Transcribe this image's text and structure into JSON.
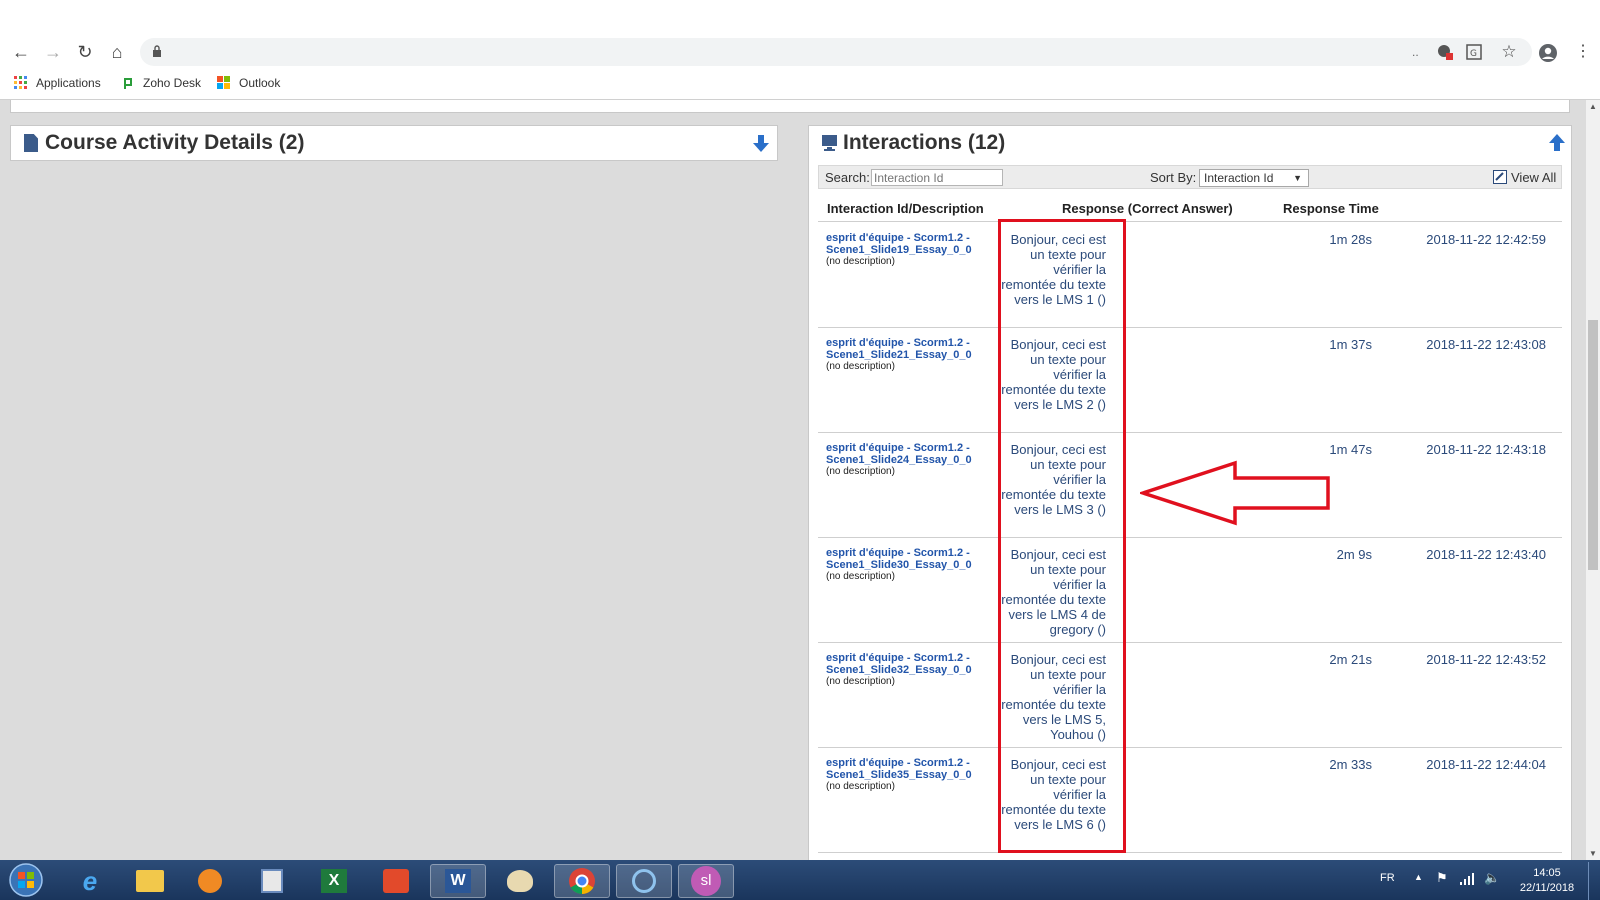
{
  "browser": {
    "bookmarks": [
      {
        "label": "Applications",
        "icon": "apps-grid-icon"
      },
      {
        "label": "Zoho Desk",
        "icon": "zoho-desk-icon"
      },
      {
        "label": "Outlook",
        "icon": "windows-logo-icon"
      }
    ],
    "url_overflow": ".."
  },
  "course_panel": {
    "title": "Course Activity Details (2)"
  },
  "interactions_panel": {
    "title": "Interactions (12)",
    "search_label": "Search:",
    "search_placeholder": "Interaction Id",
    "sort_label": "Sort By:",
    "sort_value": "Interaction Id",
    "view_all_label": "View All",
    "columns": [
      "Interaction Id/Description",
      "Response (Correct Answer)",
      "Response Time"
    ],
    "rows": [
      {
        "id_line1": "esprit d'équipe - Scorm1.2 -",
        "id_line2": "Scene1_Slide19_Essay_0_0",
        "description": "(no description)",
        "response": "Bonjour, ceci est un texte pour vérifier la remontée du texte vers le LMS 1 ()",
        "time": "1m 28s",
        "date": "2018-11-22 12:42:59"
      },
      {
        "id_line1": "esprit d'équipe - Scorm1.2 -",
        "id_line2": "Scene1_Slide21_Essay_0_0",
        "description": "(no description)",
        "response": "Bonjour, ceci est un texte pour vérifier la remontée du texte vers le LMS 2 ()",
        "time": "1m 37s",
        "date": "2018-11-22 12:43:08"
      },
      {
        "id_line1": "esprit d'équipe - Scorm1.2 -",
        "id_line2": "Scene1_Slide24_Essay_0_0",
        "description": "(no description)",
        "response": "Bonjour, ceci est un texte pour vérifier la remontée du texte vers le LMS 3 ()",
        "time": "1m 47s",
        "date": "2018-11-22 12:43:18"
      },
      {
        "id_line1": "esprit d'équipe - Scorm1.2 -",
        "id_line2": "Scene1_Slide30_Essay_0_0",
        "description": "(no description)",
        "response": "Bonjour, ceci est un texte pour vérifier la remontée du texte vers le LMS 4 de gregory ()",
        "time": "2m 9s",
        "date": "2018-11-22 12:43:40"
      },
      {
        "id_line1": "esprit d'équipe - Scorm1.2 -",
        "id_line2": "Scene1_Slide32_Essay_0_0",
        "description": "(no description)",
        "response": "Bonjour, ceci est un texte pour vérifier la remontée du texte vers le LMS 5, Youhou ()",
        "time": "2m 21s",
        "date": "2018-11-22 12:43:52"
      },
      {
        "id_line1": "esprit d'équipe - Scorm1.2 -",
        "id_line2": "Scene1_Slide35_Essay_0_0",
        "description": "(no description)",
        "response": "Bonjour, ceci est un texte pour vérifier la remontée du texte vers le LMS 6 ()",
        "time": "2m 33s",
        "date": "2018-11-22 12:44:04"
      }
    ]
  },
  "taskbar": {
    "language": "FR",
    "time": "14:05",
    "date": "22/11/2018",
    "user_badge": "sl",
    "apps": [
      "start-orb-icon",
      "internet-explorer-icon",
      "file-explorer-icon",
      "media-player-icon",
      "access-icon",
      "excel-icon",
      "pdf-icon",
      "word-icon",
      "paint-icon",
      "chrome-icon",
      "app-icon",
      "user-avatar-icon"
    ]
  },
  "colors": {
    "highlight": "#e0101e",
    "link": "#2255aa",
    "panel_title": "#333333",
    "taskbar": "#1f3d66"
  }
}
